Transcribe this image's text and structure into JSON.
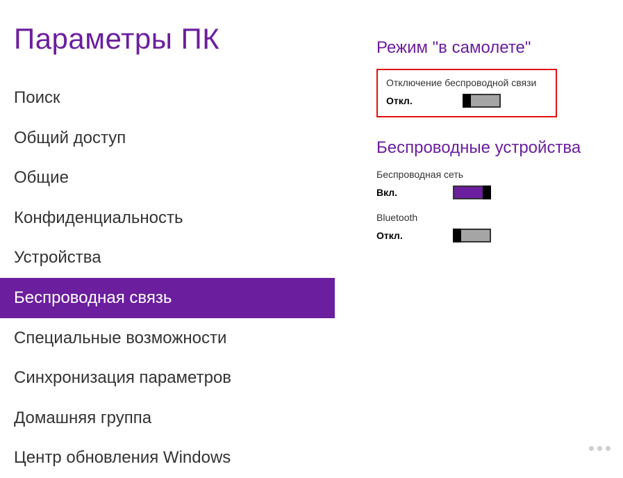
{
  "sidebar": {
    "title": "Параметры ПК",
    "items": [
      {
        "label": "Поиск",
        "active": false
      },
      {
        "label": "Общий доступ",
        "active": false
      },
      {
        "label": "Общие",
        "active": false
      },
      {
        "label": "Конфиденциальность",
        "active": false
      },
      {
        "label": "Устройства",
        "active": false
      },
      {
        "label": "Беспроводная связь",
        "active": true
      },
      {
        "label": "Специальные возможности",
        "active": false
      },
      {
        "label": "Синхронизация параметров",
        "active": false
      },
      {
        "label": "Домашняя группа",
        "active": false
      },
      {
        "label": "Центр обновления Windows",
        "active": false
      }
    ]
  },
  "content": {
    "airplane": {
      "header": "Режим \"в самолете\"",
      "label": "Отключение беспроводной связи",
      "status": "Откл.",
      "on": false
    },
    "wireless": {
      "header": "Беспроводные устройства",
      "wifi": {
        "label": "Беспроводная сеть",
        "status": "Вкл.",
        "on": true
      },
      "bluetooth": {
        "label": "Bluetooth",
        "status": "Откл.",
        "on": false
      }
    }
  }
}
